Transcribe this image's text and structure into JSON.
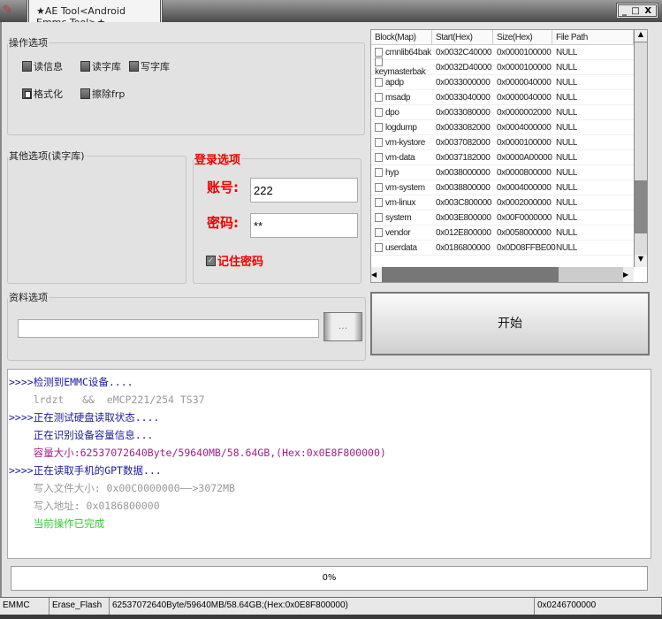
{
  "window": {
    "title": "★AE Tool<Android Emmc Tool>★",
    "controls": "_ □ X"
  },
  "ops": {
    "legend": "操作选项",
    "items": [
      "读信息",
      "读字库",
      "写字库",
      "格式化",
      "擦除frp"
    ]
  },
  "other": {
    "legend": "其他选项(读字库)"
  },
  "login": {
    "legend": "登录选项",
    "account_label": "账号:",
    "account_value": "222",
    "password_label": "密码:",
    "password_value": "**",
    "remember_label": "记住密码",
    "remember_checked": true
  },
  "data_opts": {
    "legend": "资料选项",
    "path_value": "",
    "browse_label": "..."
  },
  "table": {
    "columns": [
      "Block(Map)",
      "Start(Hex)",
      "Size(Hex)",
      "File Path"
    ],
    "rows": [
      [
        "cmnlib64bak",
        "0x0032C40000",
        "0x0000100000",
        "NULL"
      ],
      [
        "keymasterbak",
        "0x0032D40000",
        "0x0000100000",
        "NULL"
      ],
      [
        "apdp",
        "0x0033000000",
        "0x0000040000",
        "NULL"
      ],
      [
        "msadp",
        "0x0033040000",
        "0x0000040000",
        "NULL"
      ],
      [
        "dpo",
        "0x0033080000",
        "0x0000002000",
        "NULL"
      ],
      [
        "logdump",
        "0x0033082000",
        "0x0004000000",
        "NULL"
      ],
      [
        "vm-kystore",
        "0x0037082000",
        "0x0000100000",
        "NULL"
      ],
      [
        "vm-data",
        "0x0037182000",
        "0x0000A00000",
        "NULL"
      ],
      [
        "hyp",
        "0x0038000000",
        "0x0000800000",
        "NULL"
      ],
      [
        "vm-system",
        "0x0038800000",
        "0x0004000000",
        "NULL"
      ],
      [
        "vm-linux",
        "0x003C800000",
        "0x0002000000",
        "NULL"
      ],
      [
        "system",
        "0x003E800000",
        "0x00F0000000",
        "NULL"
      ],
      [
        "vendor",
        "0x012E800000",
        "0x0058000000",
        "NULL"
      ],
      [
        "userdata",
        "0x0186800000",
        "0x0D08FFBE00",
        "NULL"
      ]
    ]
  },
  "start_label": "开始",
  "log": [
    {
      "text": ">>>>检测到EMMC设备....",
      "color": "#1a1aa0"
    },
    {
      "text": "    lrdzt   &&  eMCP221/254 TS37",
      "color": "#999999"
    },
    {
      "text": ">>>>正在测试硬盘读取状态....",
      "color": "#1a1aa0"
    },
    {
      "text": "    正在识别设备容量信息...",
      "color": "#1a1aa0"
    },
    {
      "text": "    容量大小:62537072640Byte/59640MB/58.64GB,(Hex:0x0E8F800000)",
      "color": "#a0208a"
    },
    {
      "text": ">>>>正在读取手机的GPT数据...",
      "color": "#1a1aa0"
    },
    {
      "text": "    写入文件大小: 0x00C0000000——>3072MB",
      "color": "#999999"
    },
    {
      "text": "    写入地址: 0x0186800000",
      "color": "#999999"
    },
    {
      "text": "    当前操作已完成",
      "color": "#33cc33"
    }
  ],
  "progress": {
    "label": "0%",
    "value": 0
  },
  "status": [
    "EMMC",
    "Erase_Flash",
    "62537072640Byte/59640MB/58.64GB;(Hex:0x0E8F800000)",
    "0x0246700000"
  ]
}
